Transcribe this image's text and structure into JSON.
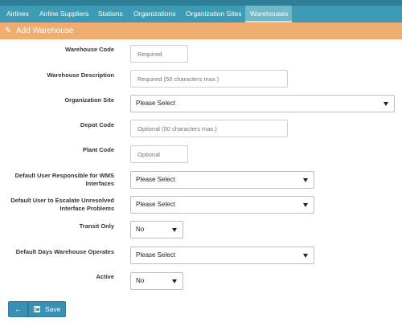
{
  "nav": {
    "tabs": [
      {
        "label": "Airlines"
      },
      {
        "label": "Airline Suppliers"
      },
      {
        "label": "Stations"
      },
      {
        "label": "Organizations"
      },
      {
        "label": "Organization Sites"
      },
      {
        "label": "Warehouses",
        "active": true
      }
    ]
  },
  "panel": {
    "icon": "pencil-icon",
    "title": "Add Warehouse"
  },
  "form": {
    "warehouse_code": {
      "label": "Warehouse Code",
      "placeholder": "Required",
      "value": ""
    },
    "warehouse_description": {
      "label": "Warehouse Description",
      "placeholder": "Required (50 characters max.)",
      "value": ""
    },
    "organization_site": {
      "label": "Organization Site",
      "selected": "Please Select"
    },
    "depot_code": {
      "label": "Depot Code",
      "placeholder": "Optional (50 characters max.)",
      "value": ""
    },
    "plant_code": {
      "label": "Plant Code",
      "placeholder": "Optional",
      "value": ""
    },
    "default_user_responsible": {
      "label_line1": "Default User Responsible for WMS",
      "label_line2": "Interfaces",
      "selected": "Please Select"
    },
    "default_user_escalate": {
      "label_line1": "Default User to Escalate Unresolved",
      "label_line2": "Interface Problems",
      "selected": "Please Select"
    },
    "transit_only": {
      "label": "Transit Only",
      "selected": "No"
    },
    "default_days": {
      "label": "Default Days Warehouse Operates",
      "selected": "Please Select"
    },
    "active": {
      "label": "Active",
      "selected": "No"
    }
  },
  "actions": {
    "back_label": "←",
    "save_label": "Save",
    "save_icon": "floppy-disk-icon"
  },
  "colors": {
    "topbar": "#2e7f97",
    "tabbar": "#3d9bb3",
    "header": "#f0ad70",
    "button": "#3a8fb5"
  }
}
